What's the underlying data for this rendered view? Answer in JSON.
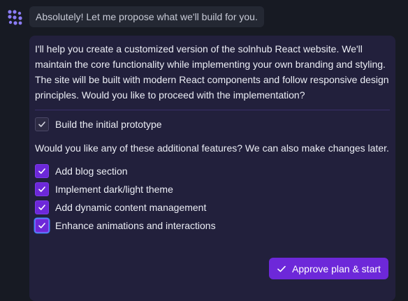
{
  "intro_message": "Absolutely! Let me propose what we'll build for you.",
  "plan": {
    "description": "I'll help you create a customized version of the solnhub React website. We'll maintain the core functionality while implementing your own branding and styling. The site will be built with modern React components and follow responsive design principles. Would you like to proceed with the implementation?",
    "base_item": {
      "label": "Build the initial prototype",
      "checked": true
    },
    "features_prompt": "Would you like any of these additional features? We can also make changes later.",
    "features": [
      {
        "label": "Add blog section",
        "checked": true
      },
      {
        "label": "Implement dark/light theme",
        "checked": true
      },
      {
        "label": "Add dynamic content management",
        "checked": true
      },
      {
        "label": "Enhance animations and interactions",
        "checked": true
      }
    ],
    "approve_label": "Approve plan & start"
  },
  "colors": {
    "background": "#171a23",
    "card": "#22203c",
    "accent": "#6d28d9",
    "focus_ring": "#3b82f6"
  }
}
